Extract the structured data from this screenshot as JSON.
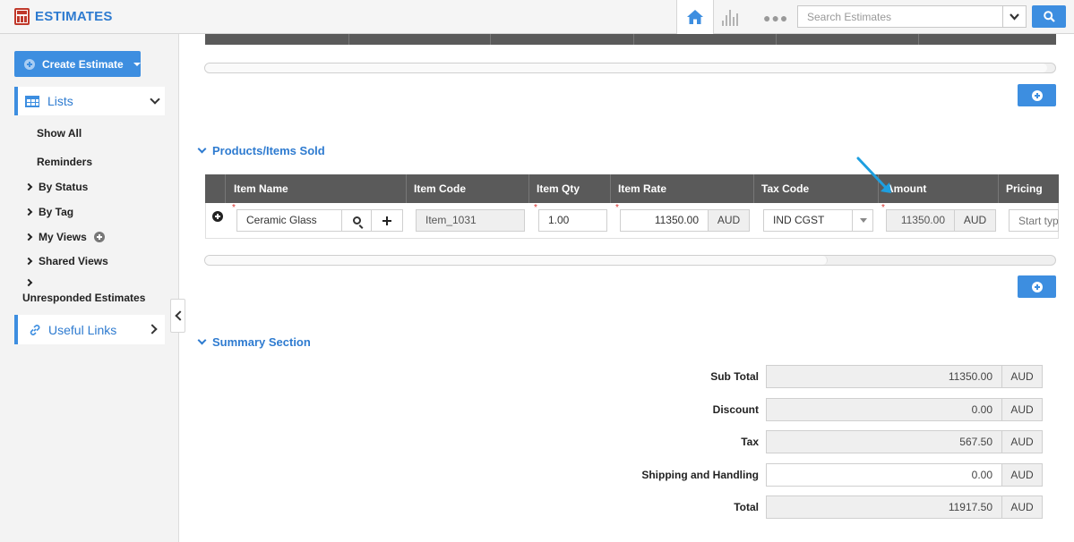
{
  "app": {
    "title": "ESTIMATES"
  },
  "search": {
    "placeholder": "Search Estimates"
  },
  "sidebar": {
    "create_label": "Create Estimate",
    "lists_label": "Lists",
    "show_all": "Show All",
    "reminders": "Reminders",
    "by_status": "By Status",
    "by_tag": "By Tag",
    "my_views": "My Views",
    "shared_views": "Shared Views",
    "unresponded": "Unresponded Estimates",
    "useful_links": "Useful Links"
  },
  "products": {
    "section_title": "Products/Items Sold",
    "columns": [
      "Item Name",
      "Item Code",
      "Item Qty",
      "Item Rate",
      "Tax Code",
      "Amount",
      "Pricing"
    ],
    "row": {
      "item_name": "Ceramic Glass",
      "item_code": "Item_1031",
      "qty": "1.00",
      "rate": "11350.00",
      "rate_unit": "AUD",
      "tax_code": "IND CGST",
      "amount": "11350.00",
      "amount_unit": "AUD",
      "pricing_placeholder": "Start typi"
    }
  },
  "summary": {
    "section_title": "Summary Section",
    "rows": [
      {
        "label": "Sub Total",
        "value": "11350.00",
        "unit": "AUD"
      },
      {
        "label": "Discount",
        "value": "0.00",
        "unit": "AUD"
      },
      {
        "label": "Tax",
        "value": "567.50",
        "unit": "AUD"
      },
      {
        "label": "Shipping and Handling",
        "value": "0.00",
        "unit": "AUD"
      },
      {
        "label": "Total",
        "value": "11917.50",
        "unit": "AUD"
      }
    ]
  },
  "colors": {
    "accent": "#3d8ee0",
    "header_dark": "#5a5a5a",
    "required": "#d9302c",
    "annotation_arrow": "#1e9fe0"
  }
}
